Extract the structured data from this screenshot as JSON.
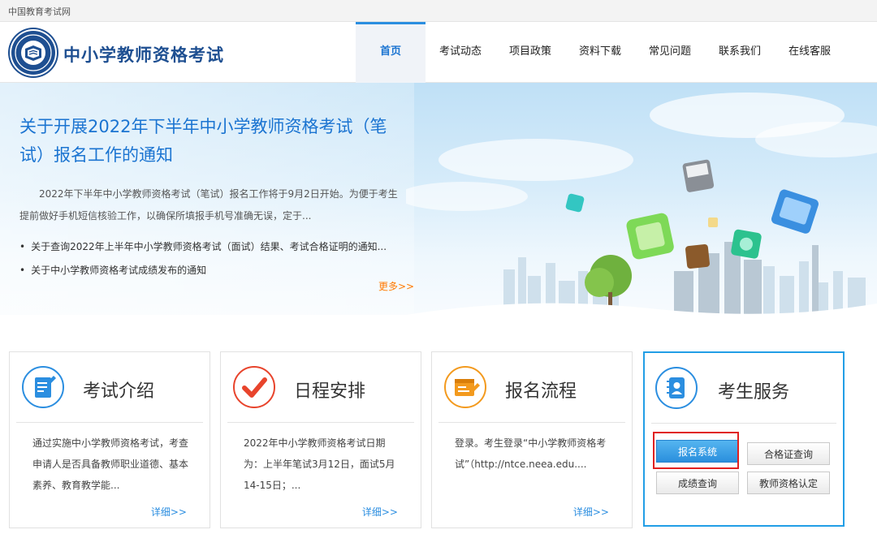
{
  "topbar": {
    "text": "中国教育考试网"
  },
  "header": {
    "site_title": "中小学教师资格考试"
  },
  "nav": [
    "首页",
    "考试动态",
    "项目政策",
    "资料下载",
    "常见问题",
    "联系我们",
    "在线客服"
  ],
  "banner": {
    "headline": "关于开展2022年下半年中小学教师资格考试（笔试）报名工作的通知",
    "summary": "2022年下半年中小学教师资格考试（笔试）报名工作将于9月2日开始。为便于考生提前做好手机短信核验工作，以确保所填报手机号准确无误，定于...",
    "news": [
      "关于查询2022年上半年中小学教师资格考试（面试）结果、考试合格证明的通知...",
      "关于中小学教师资格考试成绩发布的通知"
    ],
    "more": "更多>>"
  },
  "cards": [
    {
      "title": "考试介绍",
      "text": "通过实施中小学教师资格考试，考查申请人是否具备教师职业道德、基本素养、教育教学能...",
      "more": "详细>>",
      "icon": "document-edit-icon",
      "color": "#2b8ee0"
    },
    {
      "title": "日程安排",
      "text": "2022年中小学教师资格考试日期为：上半年笔试3月12日，面试5月14-15日；...",
      "more": "详细>>",
      "icon": "checkmark-icon",
      "color": "#e8442c"
    },
    {
      "title": "报名流程",
      "text": "登录。考生登录“中小学教师资格考试”（http://ntce.neea.edu....",
      "more": "详细>>",
      "icon": "registration-form-icon",
      "color": "#f39a1e"
    }
  ],
  "service": {
    "title": "考生服务",
    "icon": "contact-book-icon",
    "color": "#2b8ee0",
    "buttons": [
      "报名系统",
      "合格证查询",
      "成绩查询",
      "教师资格认定"
    ]
  }
}
